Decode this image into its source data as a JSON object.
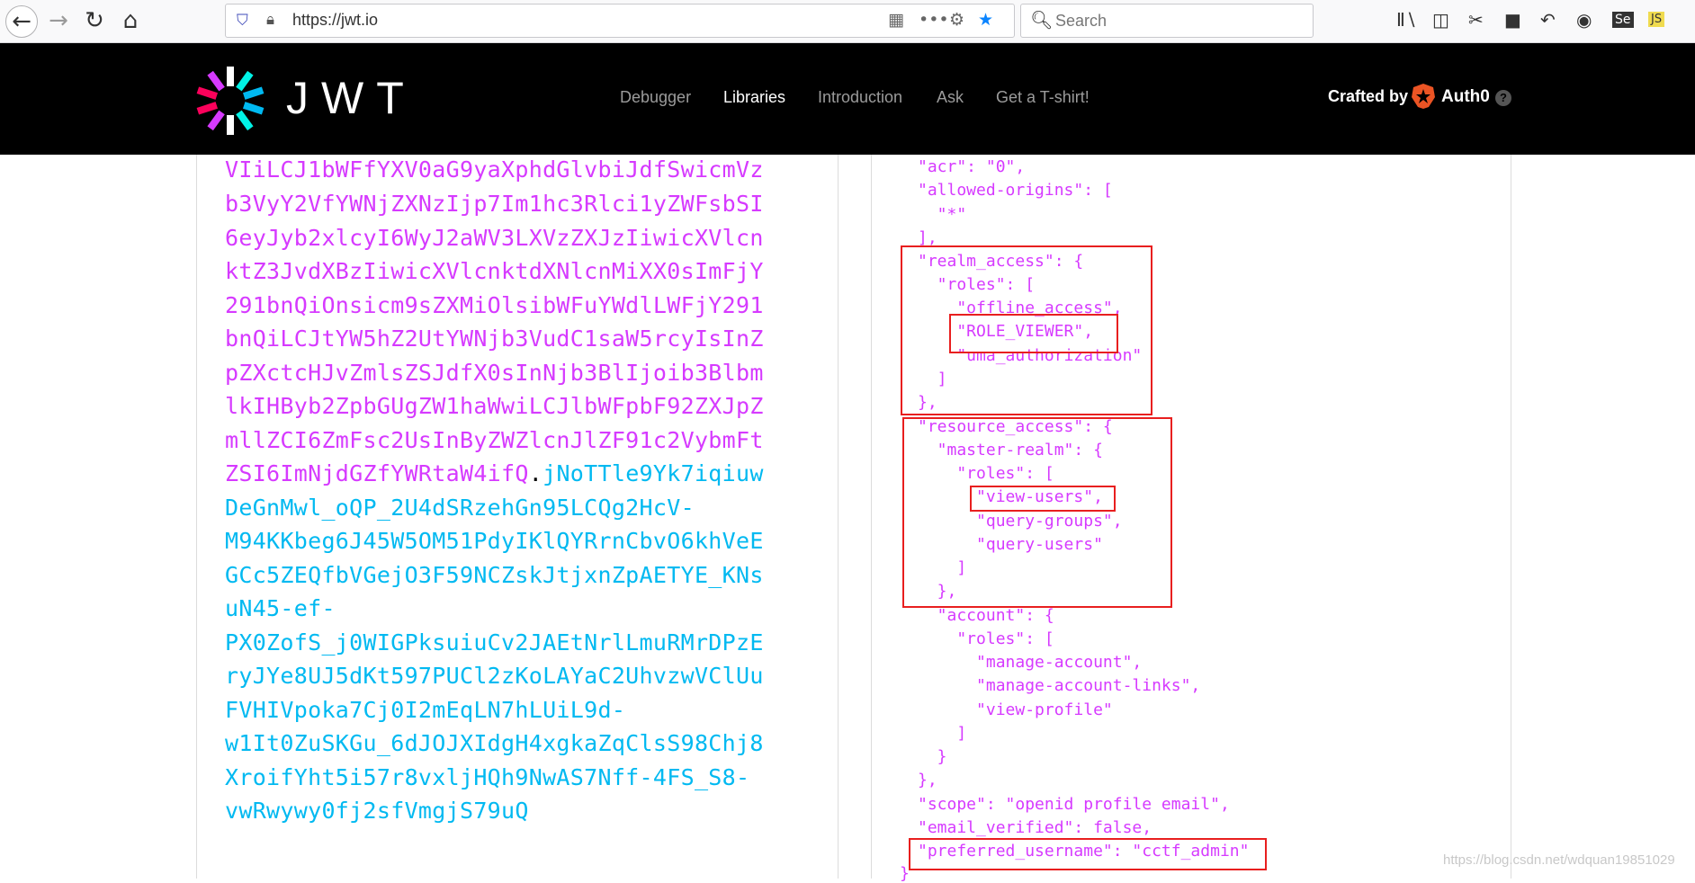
{
  "browser": {
    "url": "https://jwt.io",
    "search_placeholder": "Search"
  },
  "site": {
    "brand": "JWT",
    "nav": [
      "Debugger",
      "Libraries",
      "Introduction",
      "Ask",
      "Get a T-shirt!"
    ],
    "active_nav": "Libraries",
    "crafted_by": "Crafted by",
    "partner": "Auth0",
    "help": "?"
  },
  "encoded": {
    "payload_lines": [
      "VIiLCJ1bWFfYXV0aG9yaXphdGlvbiJdfSwicmVz",
      "b3VyY2VfYWNjZXNzIjp7Im1hc3Rlci1yZWFsbSI",
      "6eyJyb2xlcyI6WyJ2aWV3LXVzZXJzIiwicXVlcn",
      "ktZ3JvdXBzIiwicXVlcnktdXNlcnMiXX0sImFjY",
      "291bnQiOnsicm9sZXMiOlsibWFuYWdlLWFjY291",
      "bnQiLCJtYW5hZ2UtYWNjb3VudC1saW5rcyIsInZ",
      "pZXctcHJvZmlsZSJdfX0sInNjb3BlIjoib3Blbm",
      "lkIHByb2ZpbGUgZW1haWwiLCJlbWFpbF92ZXJpZ",
      "mllZCI6ZmFsc2UsInByZWZlcnJlZF91c2VybmFt"
    ],
    "mixed_payload": "ZSI6ImNjdGZfYWRtaW4ifQ",
    "dot": ".",
    "mixed_sig": "jNoTTle9Yk7iqiuw",
    "sig_lines": [
      "DeGnMwl_oQP_2U4dSRzehGn95LCQg2HcV-",
      "M94KKbeg6J45W5OM51PdyIKlQYRrnCbvO6khVeE",
      "GCc5ZEQfbVGejO3F59NCZskJtjxnZpAETYE_KNs",
      "uN45-ef-",
      "PX0ZofS_j0WIGPksuiuCv2JAEtNrlLmuRMrDPzE",
      "ryJYe8UJ5dKt597PUCl2zKoLAYaC2UhvzwVClUu",
      "FVHIVpoka7Cj0I2mEqLN7hLUiL9d-",
      "w1It0ZuSKGu_6dJOJXIdgH4xgkaZqClsS98Chj8",
      "XroifYht5i57r8vxljHQh9NwAS7Nff-4FS_S8-",
      "vwRwywy0fj2sfVmgjS79uQ"
    ]
  },
  "decoded": {
    "lines": [
      "\"acr\": \"0\",",
      "\"allowed-origins\": [",
      "  \"*\"",
      "],",
      "\"realm_access\": {",
      "  \"roles\": [",
      "    \"offline_access\",",
      "    \"ROLE_VIEWER\",",
      "    \"uma_authorization\"",
      "  ]",
      "},",
      "\"resource_access\": {",
      "  \"master-realm\": {",
      "    \"roles\": [",
      "      \"view-users\",",
      "      \"query-groups\",",
      "      \"query-users\"",
      "    ]",
      "  },",
      "  \"account\": {",
      "    \"roles\": [",
      "      \"manage-account\",",
      "      \"manage-account-links\",",
      "      \"view-profile\"",
      "    ]",
      "  }",
      "},",
      "\"scope\": \"openid profile email\",",
      "\"email_verified\": false,",
      "\"preferred_username\": \"cctf_admin\"",
      "}"
    ]
  },
  "watermark": "https://blog.csdn.net/wdquan19851029"
}
